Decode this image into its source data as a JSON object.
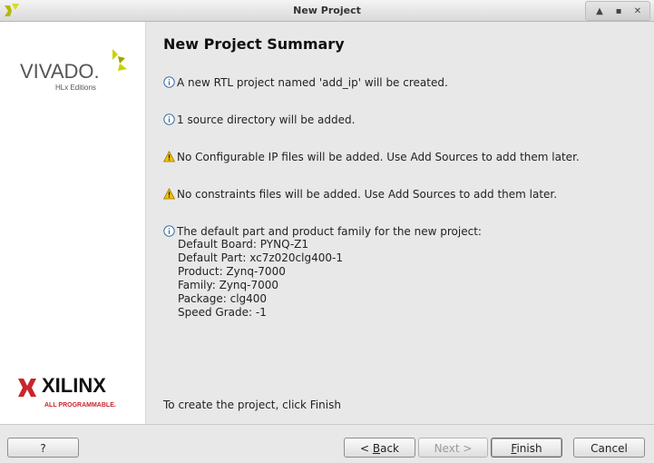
{
  "window": {
    "title": "New Project"
  },
  "sidebar": {
    "vivado_logo_text": "VIVADO.",
    "vivado_logo_sub": "HLx Editions",
    "xilinx_logo_text": "XILINX",
    "xilinx_logo_sub": "ALL PROGRAMMABLE."
  },
  "main": {
    "title": "New Project Summary",
    "messages": [
      {
        "icon": "info-icon",
        "text": "A new RTL project named 'add_ip' will be created."
      },
      {
        "icon": "info-icon",
        "text": "1 source directory will be added."
      },
      {
        "icon": "warning-icon",
        "text": "No Configurable IP files will be added. Use Add Sources to add them later."
      },
      {
        "icon": "warning-icon",
        "text": "No constraints files will be added. Use Add Sources to add them later."
      }
    ],
    "part_info": {
      "icon": "info-icon",
      "heading": "The default part and product family for the new project:",
      "lines": [
        "Default Board: PYNQ-Z1",
        "Default Part: xc7z020clg400-1",
        "Product: Zynq-7000",
        "Family: Zynq-7000",
        "Package: clg400",
        "Speed Grade: -1"
      ]
    },
    "footer": "To create the project, click Finish"
  },
  "buttons": {
    "help": "?",
    "back_prefix": "< ",
    "back_mnemonic": "B",
    "back_rest": "ack",
    "next": "Next >",
    "finish_mnemonic": "F",
    "finish_rest": "inish",
    "cancel": "Cancel"
  },
  "colors": {
    "info": "#3a6ea5",
    "warning": "#e6b800",
    "vivado_leaf": "#c6d300",
    "xilinx_red": "#c9252c"
  }
}
